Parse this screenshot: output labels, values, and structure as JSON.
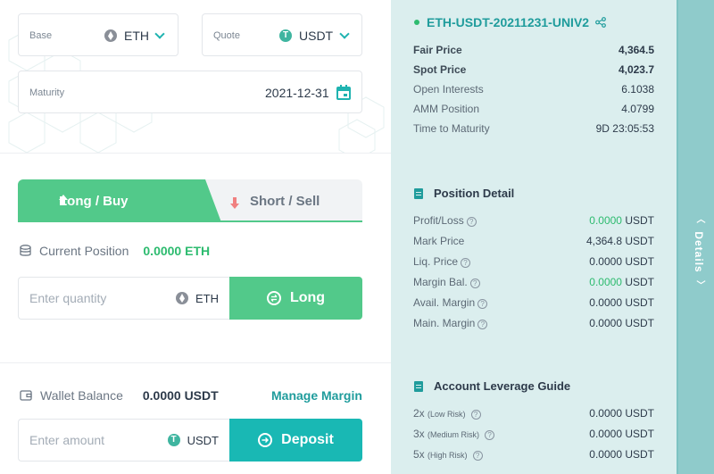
{
  "base": {
    "label": "Base",
    "value": "ETH"
  },
  "quote": {
    "label": "Quote",
    "value": "USDT"
  },
  "maturity": {
    "label": "Maturity",
    "value": "2021-12-31"
  },
  "tabs": {
    "long": "Long / Buy",
    "short": "Short / Sell"
  },
  "position": {
    "label": "Current Position",
    "value": "0.0000 ETH"
  },
  "trade": {
    "placeholder": "Enter quantity",
    "unit": "ETH",
    "button": "Long"
  },
  "wallet": {
    "label": "Wallet Balance",
    "value": "0.0000 USDT",
    "link": "Manage Margin"
  },
  "deposit": {
    "placeholder": "Enter amount",
    "unit": "USDT",
    "button": "Deposit"
  },
  "market": {
    "title": "ETH-USDT-20211231-UNIV2",
    "rows": [
      {
        "label": "Fair Price",
        "value": "4,364.5"
      },
      {
        "label": "Spot Price",
        "value": "4,023.7"
      },
      {
        "label": "Open Interests",
        "value": "6.1038"
      },
      {
        "label": "AMM Position",
        "value": "4.0799"
      },
      {
        "label": "Time to Maturity",
        "value": "9D 23:05:53"
      }
    ]
  },
  "position_detail": {
    "title": "Position Detail",
    "rows": [
      {
        "label": "Profit/Loss",
        "value": "0.0000",
        "unit": "USDT"
      },
      {
        "label": "Mark Price",
        "value": "4,364.8 USDT"
      },
      {
        "label": "Liq. Price",
        "value": "0.0000 USDT"
      },
      {
        "label": "Margin Bal.",
        "value": "0.0000",
        "unit": "USDT"
      },
      {
        "label": "Avail. Margin",
        "value": "0.0000 USDT"
      },
      {
        "label": "Main. Margin",
        "value": "0.0000 USDT"
      }
    ]
  },
  "leverage": {
    "title": "Account Leverage Guide",
    "rows": [
      {
        "label": "2x",
        "risk": "(Low Risk)",
        "value": "0.0000 USDT"
      },
      {
        "label": "3x",
        "risk": "(Medium Risk)",
        "value": "0.0000 USDT"
      },
      {
        "label": "5x",
        "risk": "(High Risk)",
        "value": "0.0000 USDT"
      }
    ]
  },
  "drawer": {
    "label": "Details"
  },
  "colors": {
    "accent": "#1fb3b0",
    "long": "#52c98a",
    "deposit": "#19b8b4",
    "panel": "#dbeeee",
    "drawer": "#8fcbcb"
  }
}
